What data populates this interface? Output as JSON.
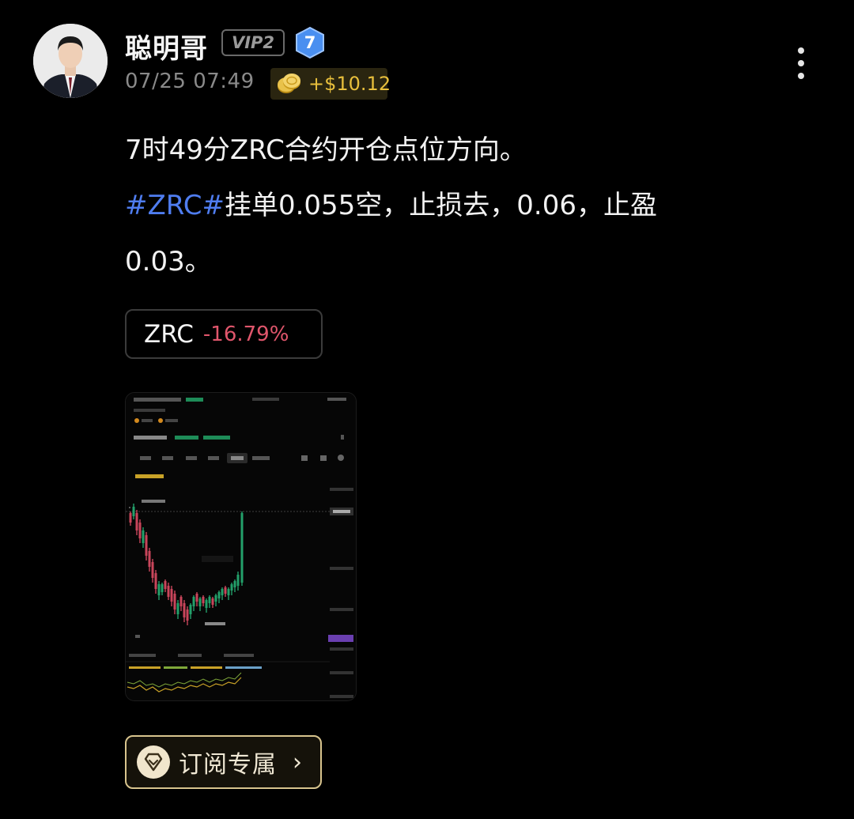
{
  "author": {
    "name": "聪明哥",
    "vip": "VIP2",
    "level": "7",
    "avatar_icon": "person-avatar"
  },
  "post": {
    "time": "07/25 07:49",
    "reward": "+$10.12",
    "line1": "7时49分ZRC合约开仓点位方向。",
    "hashtag": "#ZRC#",
    "line2_rest": "挂单0.055空，止损去，0.06，止盈",
    "line3": "0.03。"
  },
  "ticker": {
    "symbol": "ZRC",
    "change": "-16.79%"
  },
  "attachment": {
    "kind": "chart-screenshot"
  },
  "subscribe": {
    "label": "订阅专属"
  },
  "colors": {
    "background": "#000000",
    "hashtag": "#4f7df0",
    "negative": "#e0566c",
    "reward": "#e8bf3c",
    "subscribe_border": "#d8c48e"
  }
}
